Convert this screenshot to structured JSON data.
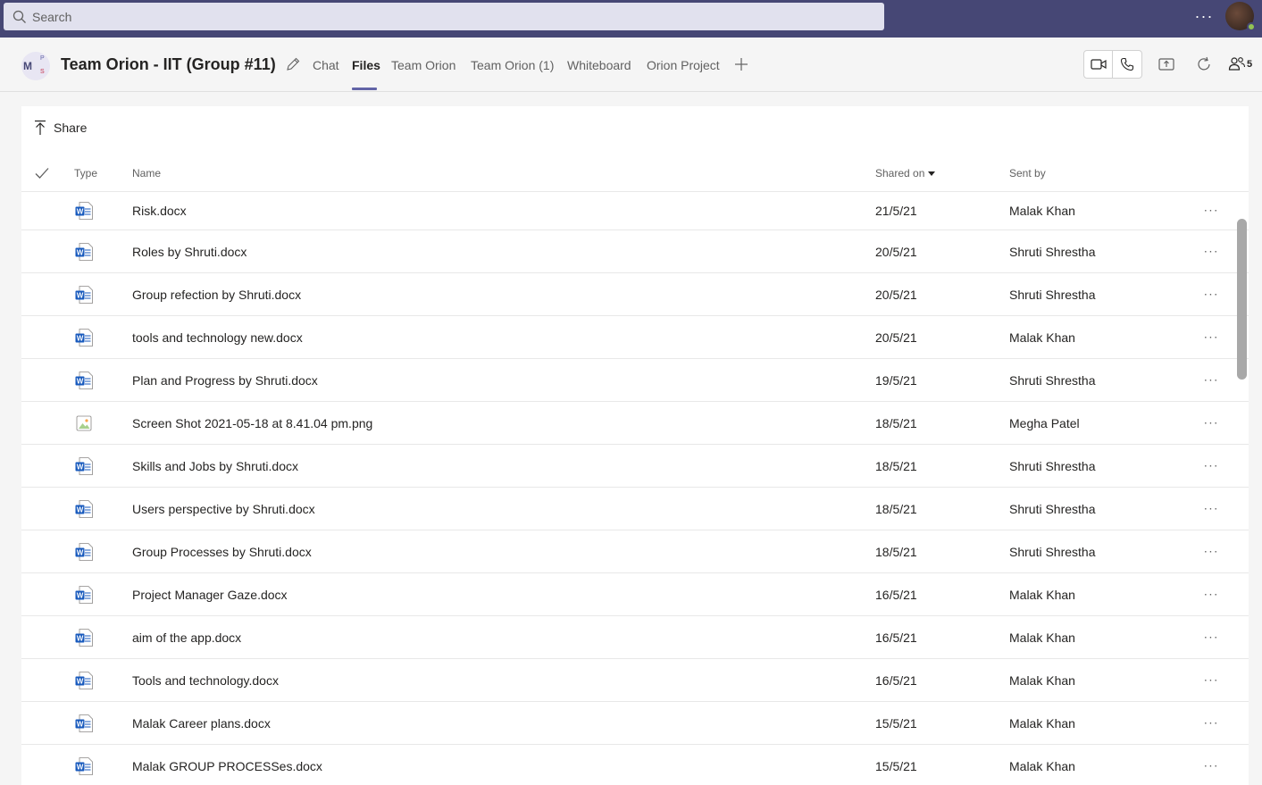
{
  "search": {
    "placeholder": "Search"
  },
  "topbar": {
    "more_label": "···"
  },
  "header": {
    "avatar_initials": {
      "main": "M",
      "top": "P",
      "bottom": "S"
    },
    "title": "Team Orion - IIT (Group #11)",
    "tabs": [
      {
        "label": "Chat",
        "active": false
      },
      {
        "label": "Files",
        "active": true
      },
      {
        "label": "Team Orion",
        "active": false
      },
      {
        "label": "Team Orion (1)",
        "active": false
      },
      {
        "label": "Whiteboard",
        "active": false
      },
      {
        "label": "Orion Project",
        "active": false
      }
    ],
    "participant_count": "5"
  },
  "toolbar": {
    "share_label": "Share"
  },
  "table": {
    "columns": {
      "type": "Type",
      "name": "Name",
      "shared_on": "Shared on",
      "sent_by": "Sent by"
    },
    "rows": [
      {
        "icon": "word-doc-icon",
        "name": "Risk.docx",
        "shared_on": "21/5/21",
        "sent_by": "Malak Khan"
      },
      {
        "icon": "word-doc-icon",
        "name": "Roles by Shruti.docx",
        "shared_on": "20/5/21",
        "sent_by": "Shruti Shrestha"
      },
      {
        "icon": "word-doc-icon",
        "name": "Group refection by Shruti.docx",
        "shared_on": "20/5/21",
        "sent_by": "Shruti Shrestha"
      },
      {
        "icon": "word-doc-icon",
        "name": "tools and technology new.docx",
        "shared_on": "20/5/21",
        "sent_by": "Malak Khan"
      },
      {
        "icon": "word-doc-icon",
        "name": "Plan and Progress by Shruti.docx",
        "shared_on": "19/5/21",
        "sent_by": "Shruti Shrestha"
      },
      {
        "icon": "image-file-icon",
        "name": "Screen Shot 2021-05-18 at 8.41.04 pm.png",
        "shared_on": "18/5/21",
        "sent_by": "Megha Patel"
      },
      {
        "icon": "word-doc-icon",
        "name": "Skills and Jobs by Shruti.docx",
        "shared_on": "18/5/21",
        "sent_by": "Shruti Shrestha"
      },
      {
        "icon": "word-doc-icon",
        "name": "Users perspective by Shruti.docx",
        "shared_on": "18/5/21",
        "sent_by": "Shruti Shrestha"
      },
      {
        "icon": "word-doc-icon",
        "name": "Group Processes by Shruti.docx",
        "shared_on": "18/5/21",
        "sent_by": "Shruti Shrestha"
      },
      {
        "icon": "word-doc-icon",
        "name": "Project Manager Gaze.docx",
        "shared_on": "16/5/21",
        "sent_by": "Malak Khan"
      },
      {
        "icon": "word-doc-icon",
        "name": "aim of the app.docx",
        "shared_on": "16/5/21",
        "sent_by": "Malak Khan"
      },
      {
        "icon": "word-doc-icon",
        "name": "Tools and technology.docx",
        "shared_on": "16/5/21",
        "sent_by": "Malak Khan"
      },
      {
        "icon": "word-doc-icon",
        "name": "Malak Career plans.docx",
        "shared_on": "15/5/21",
        "sent_by": "Malak Khan"
      },
      {
        "icon": "word-doc-icon",
        "name": "Malak GROUP PROCESSes.docx",
        "shared_on": "15/5/21",
        "sent_by": "Malak Khan"
      }
    ]
  },
  "colors": {
    "topbar_bg": "#464775",
    "accent": "#6264a7",
    "word_blue": "#185abd",
    "presence_available": "#92c353"
  }
}
